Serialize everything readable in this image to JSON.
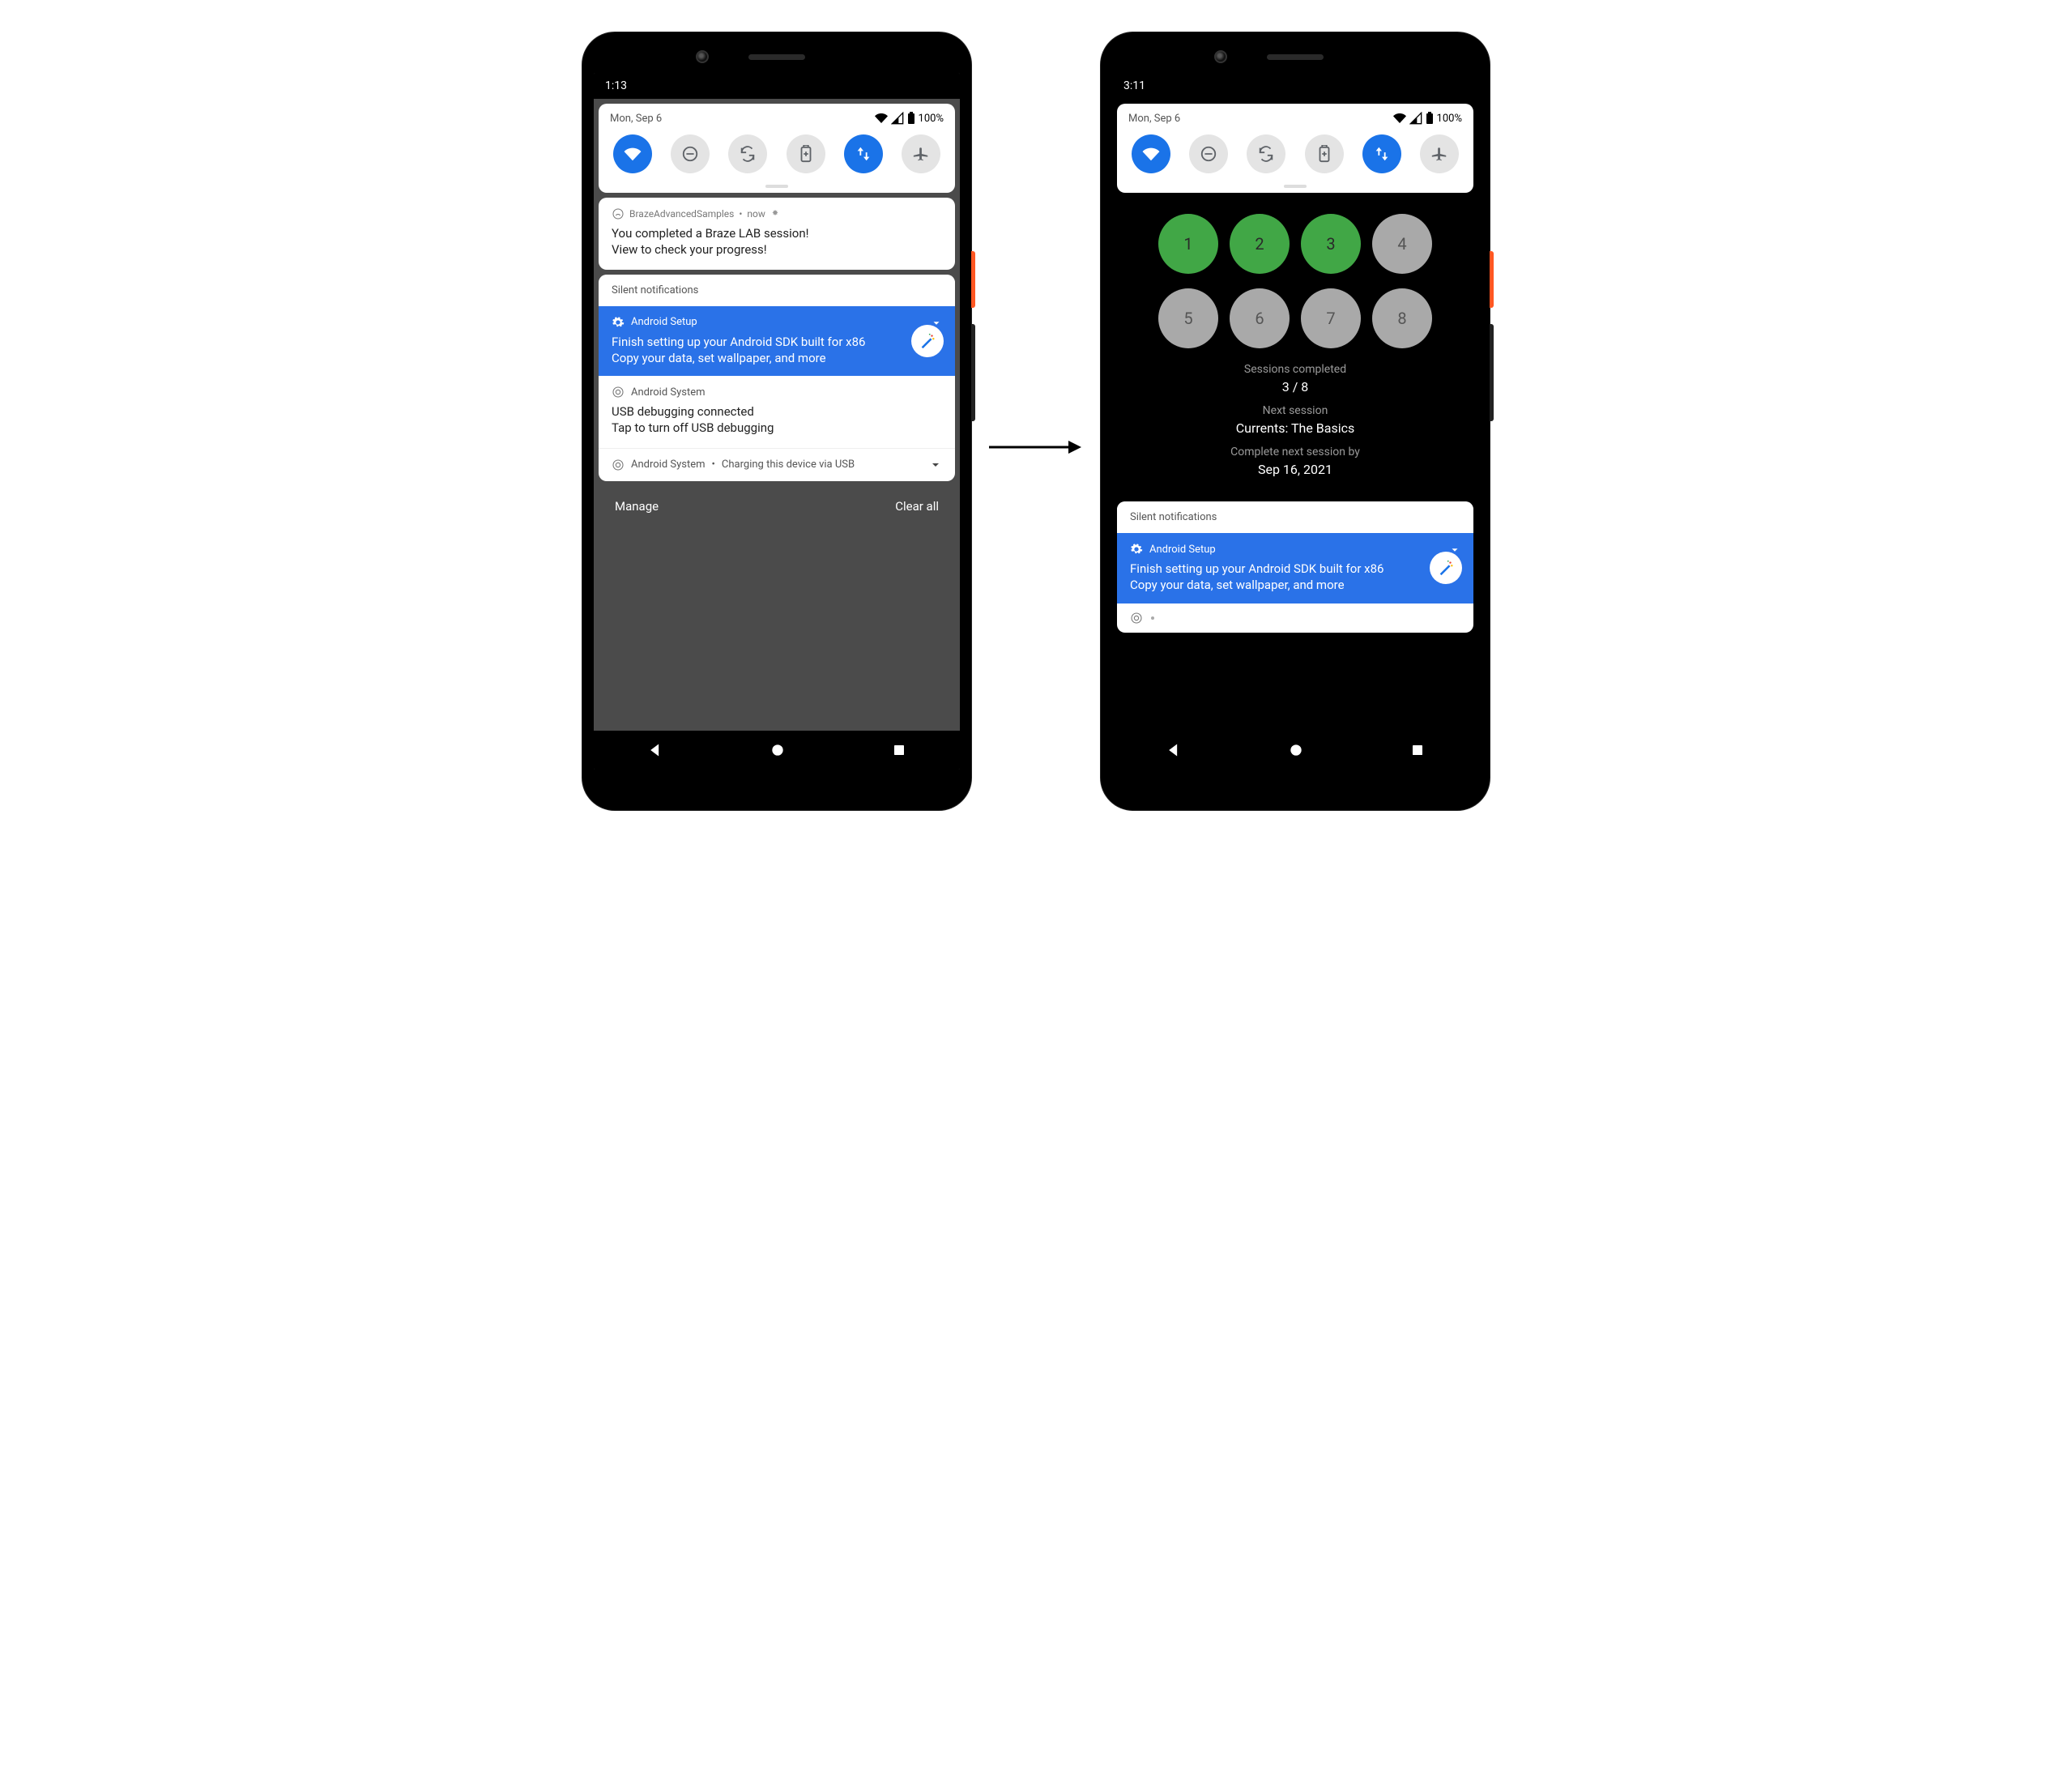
{
  "left": {
    "clock": "1:13",
    "date": "Mon, Sep 6",
    "battery": "100%",
    "tiles": [
      {
        "name": "wifi",
        "on": true
      },
      {
        "name": "dnd",
        "on": false
      },
      {
        "name": "rotate",
        "on": false
      },
      {
        "name": "battery-saver",
        "on": false
      },
      {
        "name": "data",
        "on": true
      },
      {
        "name": "airplane",
        "on": false
      }
    ],
    "push": {
      "app": "BrazeAdvancedSamples",
      "time": "now",
      "line1": "You completed a Braze LAB session!",
      "line2": "View to check your progress!"
    },
    "silent_label": "Silent notifications",
    "setup": {
      "header": "Android Setup",
      "line1": "Finish setting up your Android SDK built for x86",
      "line2": "Copy your data, set wallpaper, and more"
    },
    "system": {
      "header": "Android System",
      "line1": "USB debugging connected",
      "line2": "Tap to turn off USB debugging"
    },
    "compact": {
      "header": "Android System",
      "text": "Charging this device via USB"
    },
    "footer": {
      "manage": "Manage",
      "clear": "Clear all"
    }
  },
  "right": {
    "clock": "3:11",
    "date": "Mon, Sep 6",
    "battery": "100%",
    "tiles": [
      {
        "name": "wifi",
        "on": true
      },
      {
        "name": "dnd",
        "on": false
      },
      {
        "name": "rotate",
        "on": false
      },
      {
        "name": "battery-saver",
        "on": false
      },
      {
        "name": "data",
        "on": true
      },
      {
        "name": "airplane",
        "on": false
      }
    ],
    "progress": {
      "bubbles_row1": [
        {
          "n": "1",
          "done": true
        },
        {
          "n": "2",
          "done": true
        },
        {
          "n": "3",
          "done": true
        },
        {
          "n": "4",
          "done": false
        }
      ],
      "bubbles_row2": [
        {
          "n": "5",
          "done": false
        },
        {
          "n": "6",
          "done": false
        },
        {
          "n": "7",
          "done": false
        },
        {
          "n": "8",
          "done": false
        }
      ],
      "completed_label": "Sessions completed",
      "completed_value": "3 / 8",
      "next_label": "Next session",
      "next_value": "Currents: The Basics",
      "due_label": "Complete next session by",
      "due_value": "Sep 16, 2021"
    },
    "silent_label": "Silent notifications",
    "setup": {
      "header": "Android Setup",
      "line1": "Finish setting up your Android SDK built for x86",
      "line2": "Copy your data, set wallpaper, and more"
    }
  }
}
